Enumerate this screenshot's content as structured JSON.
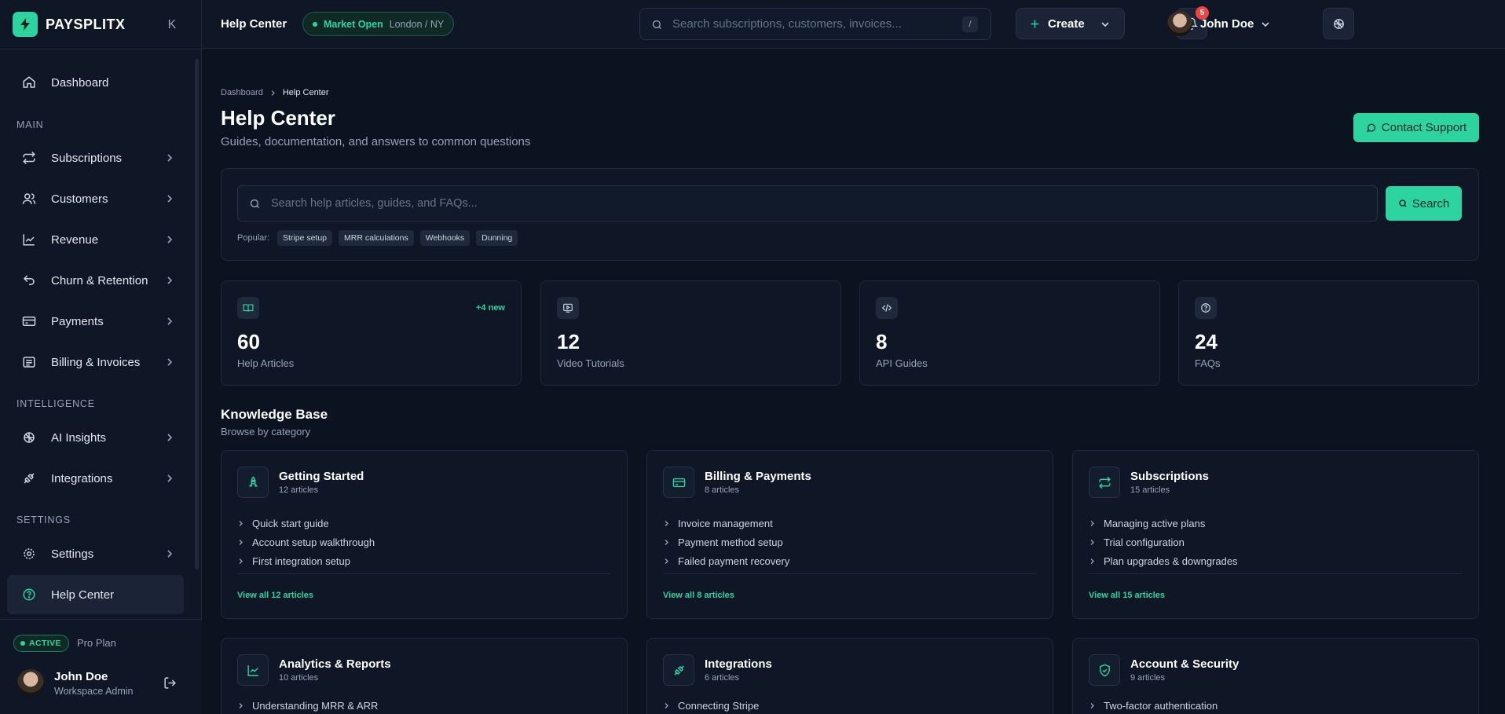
{
  "brand": {
    "name": "PAYSPLITX"
  },
  "sidebar": {
    "collapse_label": "K",
    "dashboard": "Dashboard",
    "sections": {
      "main": "MAIN",
      "intelligence": "INTELLIGENCE",
      "settings": "SETTINGS"
    },
    "items": [
      {
        "label": "Subscriptions"
      },
      {
        "label": "Customers"
      },
      {
        "label": "Revenue"
      },
      {
        "label": "Churn & Retention"
      },
      {
        "label": "Payments"
      },
      {
        "label": "Billing & Invoices"
      },
      {
        "label": "AI Insights"
      },
      {
        "label": "Integrations"
      },
      {
        "label": "Settings"
      },
      {
        "label": "Help Center"
      }
    ],
    "footer": {
      "status": "ACTIVE",
      "plan": "Pro Plan",
      "name": "John Doe",
      "role": "Workspace Admin"
    }
  },
  "topbar": {
    "title": "Help Center",
    "market_status": "Market Open",
    "market_cities": "London / NY",
    "search_placeholder": "Search subscriptions, customers, invoices...",
    "search_shortcut": "/",
    "notification_count": "5",
    "create_label": "Create",
    "user_name": "John Doe"
  },
  "page": {
    "breadcrumb": [
      "Dashboard",
      "Help Center"
    ],
    "title": "Help Center",
    "subtitle": "Guides, documentation, and answers to common questions",
    "contact_label": "Contact Support"
  },
  "help_search": {
    "placeholder": "Search help articles, guides, and FAQs...",
    "button": "Search",
    "popular_label": "Popular:",
    "tags": [
      "Stripe setup",
      "MRR calculations",
      "Webhooks",
      "Dunning"
    ]
  },
  "stats": [
    {
      "value": "60",
      "label": "Help Articles",
      "badge": "+4 new",
      "icon": "book-icon"
    },
    {
      "value": "12",
      "label": "Video Tutorials",
      "icon": "video-icon"
    },
    {
      "value": "8",
      "label": "API Guides",
      "icon": "code-icon"
    },
    {
      "value": "24",
      "label": "FAQs",
      "icon": "question-icon"
    }
  ],
  "knowledge_base": {
    "title": "Knowledge Base",
    "subtitle": "Browse by category",
    "categories": [
      {
        "title": "Getting Started",
        "count": "12 articles",
        "icon": "rocket-icon",
        "articles": [
          "Quick start guide",
          "Account setup walkthrough",
          "First integration setup"
        ],
        "view_all": "View all 12 articles"
      },
      {
        "title": "Billing & Payments",
        "count": "8 articles",
        "icon": "credit-card-icon",
        "articles": [
          "Invoice management",
          "Payment method setup",
          "Failed payment recovery"
        ],
        "view_all": "View all 8 articles"
      },
      {
        "title": "Subscriptions",
        "count": "15 articles",
        "icon": "repeat-icon",
        "articles": [
          "Managing active plans",
          "Trial configuration",
          "Plan upgrades & downgrades"
        ],
        "view_all": "View all 15 articles"
      },
      {
        "title": "Analytics & Reports",
        "count": "10 articles",
        "icon": "chart-line-icon",
        "articles": [
          "Understanding MRR & ARR"
        ]
      },
      {
        "title": "Integrations",
        "count": "6 articles",
        "icon": "plug-icon",
        "articles": [
          "Connecting Stripe"
        ]
      },
      {
        "title": "Account & Security",
        "count": "9 articles",
        "icon": "shield-check-icon",
        "articles": [
          "Two-factor authentication"
        ]
      }
    ]
  },
  "colors": {
    "accent": "#2dd4a0",
    "background": "#0b1220",
    "panel": "#0f1726",
    "danger": "#ef4444"
  }
}
